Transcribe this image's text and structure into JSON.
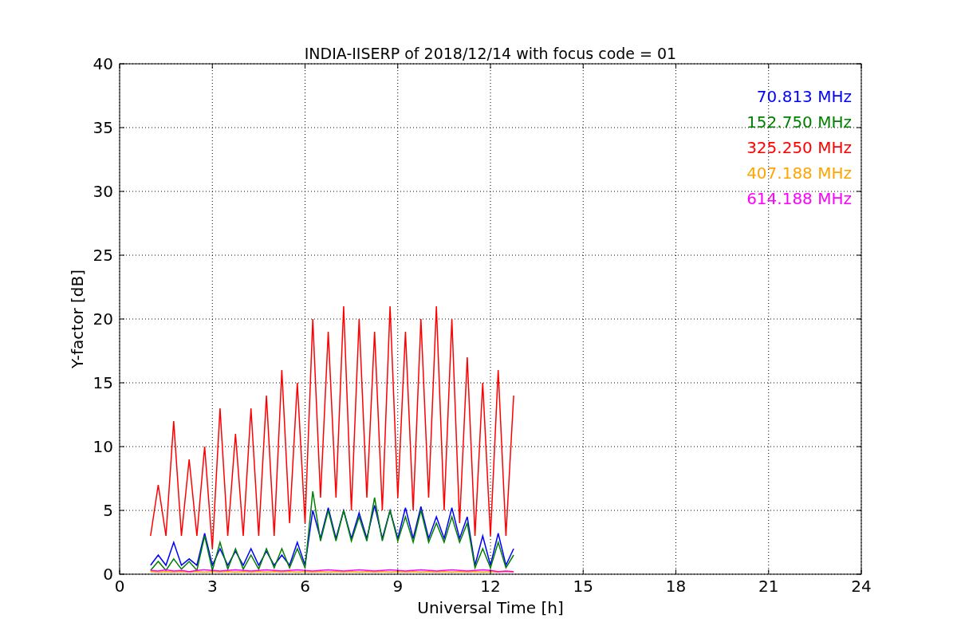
{
  "chart_data": {
    "type": "line",
    "title": "INDIA-IISERP of 2018/12/14 with focus code = 01",
    "xlabel": "Universal Time [h]",
    "ylabel": "Y-factor [dB]",
    "x": [
      1,
      1.25,
      1.5,
      1.75,
      2,
      2.25,
      2.5,
      2.75,
      3,
      3.25,
      3.5,
      3.75,
      4,
      4.25,
      4.5,
      4.75,
      5,
      5.25,
      5.5,
      5.75,
      6,
      6.25,
      6.5,
      6.75,
      7,
      7.25,
      7.5,
      7.75,
      8,
      8.25,
      8.5,
      8.75,
      9,
      9.25,
      9.5,
      9.75,
      10,
      10.25,
      10.5,
      10.75,
      11,
      11.25,
      11.5,
      11.75,
      12,
      12.25,
      12.5,
      12.75
    ],
    "series": [
      {
        "name": "70.813 MHz",
        "color": "#0000ff",
        "values": [
          0.7,
          1.5,
          0.7,
          2.5,
          0.7,
          1.2,
          0.7,
          3.2,
          0.7,
          2,
          0.7,
          1.8,
          0.7,
          2,
          0.7,
          1.8,
          0.7,
          1.5,
          0.7,
          2.5,
          0.7,
          5,
          2.8,
          5.2,
          2.8,
          5,
          2.8,
          4.8,
          2.8,
          5.4,
          2.8,
          5,
          2.8,
          5.2,
          2.8,
          5.3,
          2.8,
          4.5,
          2.8,
          5.2,
          2.8,
          4.5,
          0.7,
          3,
          0.7,
          3.2,
          0.7,
          2
        ]
      },
      {
        "name": "152.750 MHz",
        "color": "#008000",
        "values": [
          0.3,
          1,
          0.3,
          1.2,
          0.4,
          1,
          0.3,
          3,
          0.3,
          2.5,
          0.4,
          2,
          0.4,
          1.5,
          0.4,
          2,
          0.5,
          2,
          0.5,
          2,
          0.5,
          6.5,
          2.6,
          5,
          2.6,
          5,
          2.6,
          4.5,
          2.6,
          6,
          2.6,
          5,
          2.6,
          4.5,
          2.5,
          5,
          2.5,
          4,
          2.5,
          4.5,
          2.5,
          4,
          0.5,
          2,
          0.5,
          2.5,
          0.5,
          1.5
        ]
      },
      {
        "name": "325.250 MHz",
        "color": "#ff0000",
        "values": [
          3,
          7,
          3,
          12,
          3,
          9,
          3,
          10,
          2,
          13,
          3,
          11,
          3,
          13,
          3,
          14,
          3,
          16,
          4,
          15,
          4,
          20,
          6,
          19,
          6,
          21,
          5,
          20,
          6,
          19,
          5,
          21,
          6,
          19,
          5,
          20,
          6,
          21,
          5,
          20,
          4,
          17,
          3,
          15,
          3,
          16,
          3,
          14
        ]
      },
      {
        "name": "407.188 MHz",
        "color": "#ffa500",
        "values": [
          0.2,
          0.15,
          0.2,
          0.15,
          0.2,
          0.15,
          0.2,
          0.15,
          0.2,
          0.15,
          0.2,
          0.15,
          0.2,
          0.15,
          0.2,
          0.15,
          0.2,
          0.15,
          0.2,
          0.15,
          0.2,
          0.15,
          0.2,
          0.15,
          0.2,
          0.15,
          0.2,
          0.15,
          0.2,
          0.15,
          0.2,
          0.15,
          0.2,
          0.15,
          0.2,
          0.15,
          0.2,
          0.15,
          0.2,
          0.15,
          0.2,
          0.15,
          0.2,
          0.15,
          0.2,
          0.15,
          0.2,
          0.15
        ]
      },
      {
        "name": "614.188 MHz",
        "color": "#ff00ff",
        "values": [
          0.3,
          0.25,
          0.35,
          0.25,
          0.3,
          0.2,
          0.3,
          0.35,
          0.3,
          0.25,
          0.3,
          0.35,
          0.3,
          0.25,
          0.3,
          0.35,
          0.3,
          0.25,
          0.3,
          0.35,
          0.3,
          0.25,
          0.3,
          0.35,
          0.3,
          0.25,
          0.3,
          0.35,
          0.3,
          0.25,
          0.3,
          0.35,
          0.3,
          0.25,
          0.3,
          0.35,
          0.3,
          0.25,
          0.3,
          0.35,
          0.3,
          0.25,
          0.3,
          0.35,
          0.3,
          0.2,
          0.25,
          0.2
        ]
      }
    ],
    "grid": true,
    "xlim": [
      0,
      24
    ],
    "ylim": [
      0,
      40
    ],
    "xticks": [
      0,
      3,
      6,
      9,
      12,
      15,
      18,
      21,
      24
    ],
    "yticks": [
      0,
      5,
      10,
      15,
      20,
      25,
      30,
      35,
      40
    ]
  }
}
